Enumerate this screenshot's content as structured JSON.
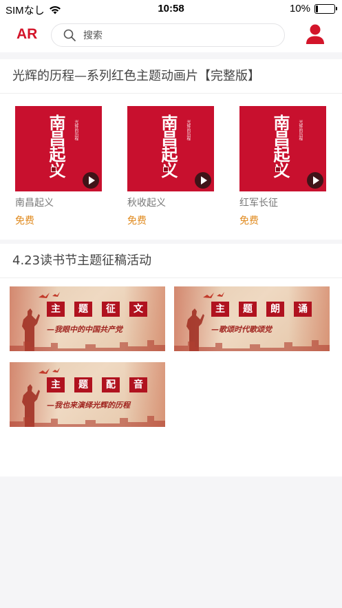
{
  "status_bar": {
    "carrier": "SIMなし",
    "time": "10:58",
    "battery_percent_label": "10%",
    "battery_level": 0.1
  },
  "header": {
    "logo": "AR",
    "search_placeholder": "搜索",
    "icons": {
      "search": "search-icon",
      "user": "user-icon"
    },
    "brand_color": "#d3152a"
  },
  "animation_section": {
    "title": "光辉的历程—系列红色主题动画片【完整版】",
    "items": [
      {
        "thumb_title": "南昌起义",
        "thumb_subtitle": "光辉的历程",
        "name": "南昌起义",
        "price": "免费"
      },
      {
        "thumb_title": "南昌起义",
        "thumb_subtitle": "光辉的历程",
        "name": "秋收起义",
        "price": "免费"
      },
      {
        "thumb_title": "南昌起义",
        "thumb_subtitle": "光辉的历程",
        "name": "红军长征",
        "price": "免费"
      }
    ],
    "price_color": "#e08a1e"
  },
  "event_section": {
    "title": "4.23读书节主题征稿活动",
    "cards": [
      {
        "chars": [
          "主",
          "题",
          "征",
          "文"
        ],
        "subtitle": "—我眼中的中国共产党"
      },
      {
        "chars": [
          "主",
          "题",
          "朗",
          "诵"
        ],
        "subtitle": "—歌颂时代歌颂党"
      },
      {
        "chars": [
          "主",
          "题",
          "配",
          "音"
        ],
        "subtitle": "—我也来演绎光辉的历程"
      }
    ]
  }
}
